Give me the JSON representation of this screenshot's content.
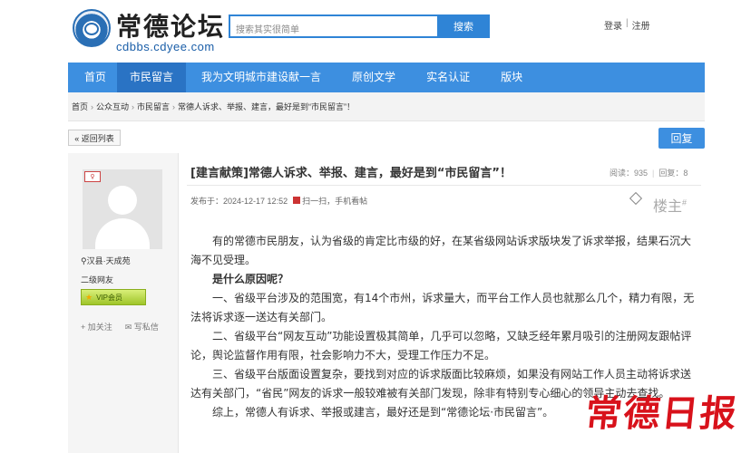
{
  "header": {
    "logo_title": "常德论坛",
    "logo_url": "cdbbs.cdyee.com",
    "search_placeholder": "搜索其实很简单",
    "search_button": "搜索",
    "login": "登录",
    "register": "注册",
    "separator": "|"
  },
  "nav": {
    "items": [
      {
        "label": "首页"
      },
      {
        "label": "市民留言"
      },
      {
        "label": "我为文明城市建设献一言"
      },
      {
        "label": "原创文学"
      },
      {
        "label": "实名认证"
      },
      {
        "label": "版块"
      }
    ],
    "active_index": 1
  },
  "breadcrumb": {
    "items": [
      "首页",
      "公众互动",
      "市民留言",
      "常德人诉求、举报、建言，最好是到“市民留言”！"
    ],
    "arrow": "›"
  },
  "actions": {
    "back": "« 返回列表",
    "reply": "回复"
  },
  "user": {
    "name": "汉县·天成苑",
    "level": "二级网友",
    "badge": "VIP会员",
    "follow": "+ 加关注",
    "message": "写私信"
  },
  "post": {
    "title": "[建言献策]常德人诉求、举报、建言，最好是到“市民留言”！",
    "views_label": "阅读：",
    "views": "935",
    "replies_label": "回复：",
    "replies": "8",
    "posted_label": "发布于：",
    "posted_time": "2024-12-17 12:52",
    "scan": "扫一扫，手机看帖",
    "floor": "楼主",
    "floor_mark": "#",
    "paragraphs": [
      "有的常德市民朋友，认为省级的肯定比市级的好，在某省级网站诉求版块发了诉求举报，结果石沉大海不见受理。",
      "是什么原因呢？",
      "一、省级平台涉及的范围宽，有14个市州，诉求量大，而平台工作人员也就那么几个，精力有限，无法将诉求逐一送达有关部门。",
      "二、省级平台“网友互动”功能设置极其简单，几乎可以忽略，又缺乏经年累月吸引的注册网友跟帖评论，舆论监督作用有限，社会影响力不大，受理工作压力不足。",
      "三、省级平台版面设置复杂，要找到对应的诉求版面比较麻烦，如果没有网站工作人员主动将诉求送达有关部门，“省民”网友的诉求一般较难被有关部门发现，除非有特别专心细心的领导主动去查找。",
      "综上，常德人有诉求、举报或建言，最好还是到“常德论坛·市民留言”。"
    ]
  },
  "watermark": "常德日报",
  "colors": {
    "nav_blue": "#3d8fe0",
    "nav_active": "#2a73c4",
    "brand_red": "#d8121b"
  }
}
